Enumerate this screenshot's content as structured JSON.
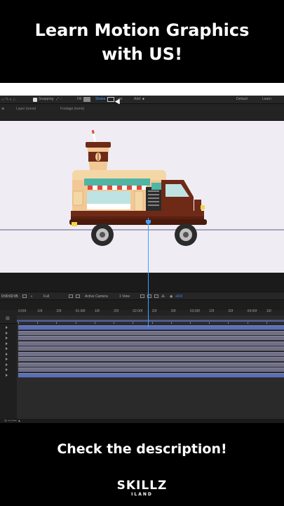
{
  "headline": {
    "line1": "Learn Motion Graphics",
    "line2": "with US!"
  },
  "app": {
    "toolbar": {
      "snapping_label": "Snapping",
      "fill_label": "Fill:",
      "stroke_label": "Stroke:",
      "stroke_width": "- px",
      "add_label": "Add:",
      "workspace_default": "Default",
      "workspace_learn": "Learn"
    },
    "panels": {
      "layer_tab": "Layer (none)",
      "footage_tab": "Footage (none)"
    },
    "viewer_controls": {
      "timecode": "0:00:02:05",
      "resolution": "Full",
      "camera": "Active Camera",
      "views": "1 View",
      "exposure": "+0.0"
    },
    "ruler_labels": [
      "0:00f",
      "10f",
      "20f",
      "01:00f",
      "10f",
      "20f",
      "02:00f",
      "10f",
      "20f",
      "03:00f",
      "10f",
      "20f",
      "04:00f",
      "10f"
    ],
    "track_count": 10,
    "colors": {
      "accent": "#3fa0ff",
      "viewer_bg": "#efedf3",
      "truck_body": "#f1c896",
      "truck_bottom": "#6e2a17",
      "awning_teal": "#4fb5a5",
      "awning_red": "#d94a3a"
    }
  },
  "cta": "Check the description!",
  "logo": {
    "main": "SKILLZ",
    "sub": "ILAND"
  }
}
